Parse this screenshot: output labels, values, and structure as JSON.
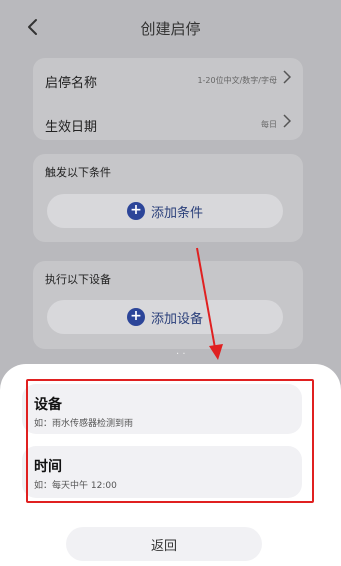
{
  "header": {
    "back_icon": "chevron-left-icon",
    "title": "创建启停"
  },
  "card1": {
    "name_label": "启停名称",
    "name_placeholder": "1-20位中文/数字/字母",
    "date_label": "生效日期",
    "date_value": "每日"
  },
  "card2": {
    "label": "触发以下条件",
    "add_button": "添加条件"
  },
  "card3": {
    "label": "执行以下设备",
    "add_button": "添加设备"
  },
  "sheet": {
    "option1": {
      "title": "设备",
      "subtitle": "如：雨水传感器检测到雨"
    },
    "option2": {
      "title": "时间",
      "subtitle": "如：每天中午 12:00"
    },
    "return_button": "返回"
  },
  "colors": {
    "accent": "#2c4599",
    "highlight": "#e02020",
    "overlay": "#b9b9bd"
  }
}
